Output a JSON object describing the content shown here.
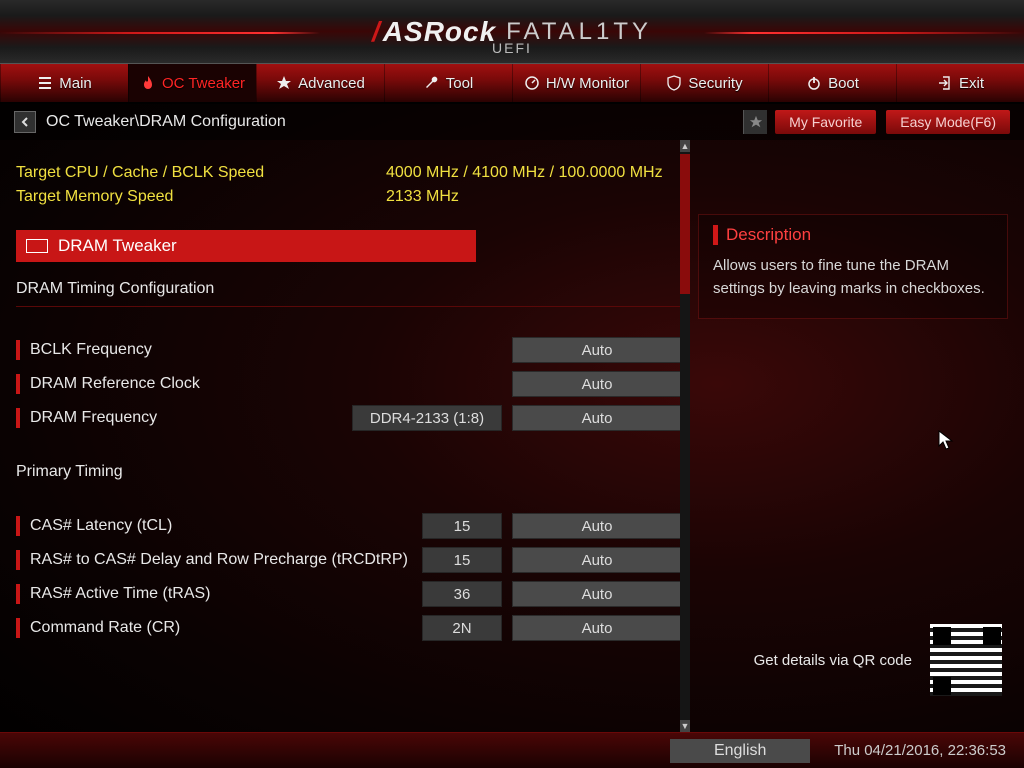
{
  "brand": {
    "asrock": "ASRock",
    "fatal1ty": "FATAL1TY",
    "uefi": "UEFI"
  },
  "tabs": [
    {
      "label": "Main"
    },
    {
      "label": "OC Tweaker"
    },
    {
      "label": "Advanced"
    },
    {
      "label": "Tool"
    },
    {
      "label": "H/W Monitor"
    },
    {
      "label": "Security"
    },
    {
      "label": "Boot"
    },
    {
      "label": "Exit"
    }
  ],
  "breadcrumb": "OC Tweaker\\DRAM Configuration",
  "buttons": {
    "favorite": "My Favorite",
    "easy_mode": "Easy Mode(F6)"
  },
  "targets": {
    "cpu_label": "Target CPU / Cache / BCLK Speed",
    "cpu_value": "4000 MHz / 4100 MHz / 100.0000 MHz",
    "mem_label": "Target Memory Speed",
    "mem_value": "2133 MHz"
  },
  "highlight_item": "DRAM Tweaker",
  "section1": "DRAM Timing Configuration",
  "settings_a": [
    {
      "name": "BCLK Frequency",
      "auto": "Auto"
    },
    {
      "name": "DRAM Reference Clock",
      "auto": "Auto"
    },
    {
      "name": "DRAM Frequency",
      "mid": "DDR4-2133 (1:8)",
      "auto": "Auto"
    }
  ],
  "section2": "Primary Timing",
  "settings_b": [
    {
      "name": "CAS# Latency (tCL)",
      "val": "15",
      "auto": "Auto"
    },
    {
      "name": "RAS# to CAS# Delay and Row Precharge (tRCDtRP)",
      "val": "15",
      "auto": "Auto"
    },
    {
      "name": "RAS# Active Time (tRAS)",
      "val": "36",
      "auto": "Auto"
    },
    {
      "name": "Command Rate (CR)",
      "val": "2N",
      "auto": "Auto"
    }
  ],
  "description": {
    "title": "Description",
    "text": "Allows users to fine tune the DRAM settings by leaving marks in checkboxes."
  },
  "qr_caption": "Get details via QR code",
  "footer": {
    "language": "English",
    "datetime": "Thu 04/21/2016, 22:36:53"
  }
}
